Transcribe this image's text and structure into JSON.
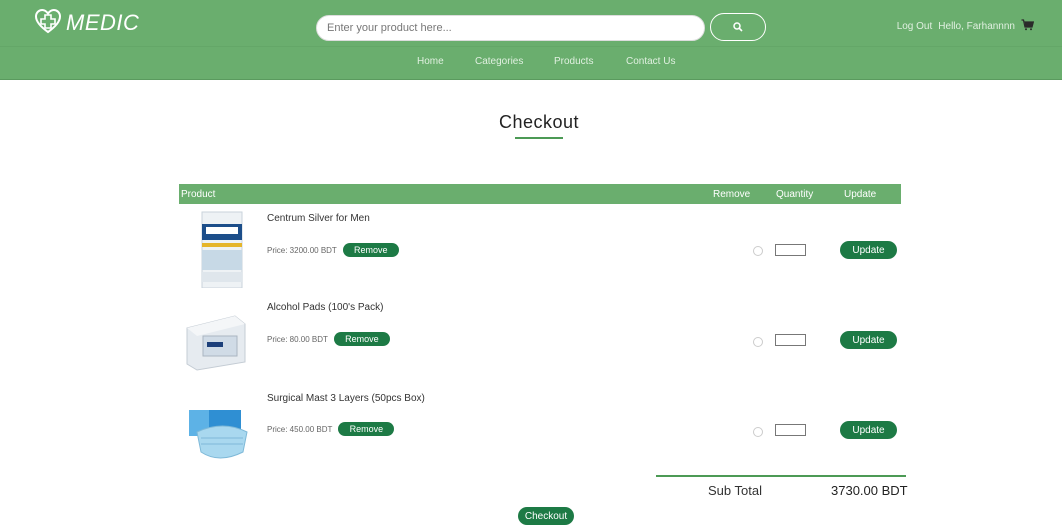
{
  "brand": {
    "name": "MEDIC"
  },
  "search": {
    "placeholder": "Enter your product here..."
  },
  "user": {
    "logout_label": "Log Out",
    "greeting": "Hello, Farhannnn"
  },
  "nav": {
    "items": [
      "Home",
      "Categories",
      "Products",
      "Contact Us"
    ]
  },
  "page": {
    "title": "Checkout"
  },
  "table": {
    "headers": {
      "product": "Product",
      "remove": "Remove",
      "quantity": "Quantity",
      "update": "Update"
    }
  },
  "cart": [
    {
      "name": "Centrum Silver for Men",
      "price": "Price: 3200.00 BDT",
      "remove_label": "Remove",
      "update_label": "Update",
      "quantity": ""
    },
    {
      "name": "Alcohol Pads (100's Pack)",
      "price": "Price: 80.00 BDT",
      "remove_label": "Remove",
      "update_label": "Update",
      "quantity": ""
    },
    {
      "name": "Surgical Mast 3 Layers (50pcs Box)",
      "price": "Price: 450.00 BDT",
      "remove_label": "Remove",
      "update_label": "Update",
      "quantity": ""
    }
  ],
  "summary": {
    "subtotal_label": "Sub Total",
    "subtotal_value": "3730.00 BDT"
  },
  "checkout": {
    "button_label": "Checkout"
  },
  "colors": {
    "header_green": "#6aae6e",
    "button_green": "#1d7a45",
    "accent_line": "#4c9a55"
  },
  "icons": {
    "logo": "medical-cross-heart-icon",
    "search": "search-icon",
    "cart": "cart-icon"
  }
}
